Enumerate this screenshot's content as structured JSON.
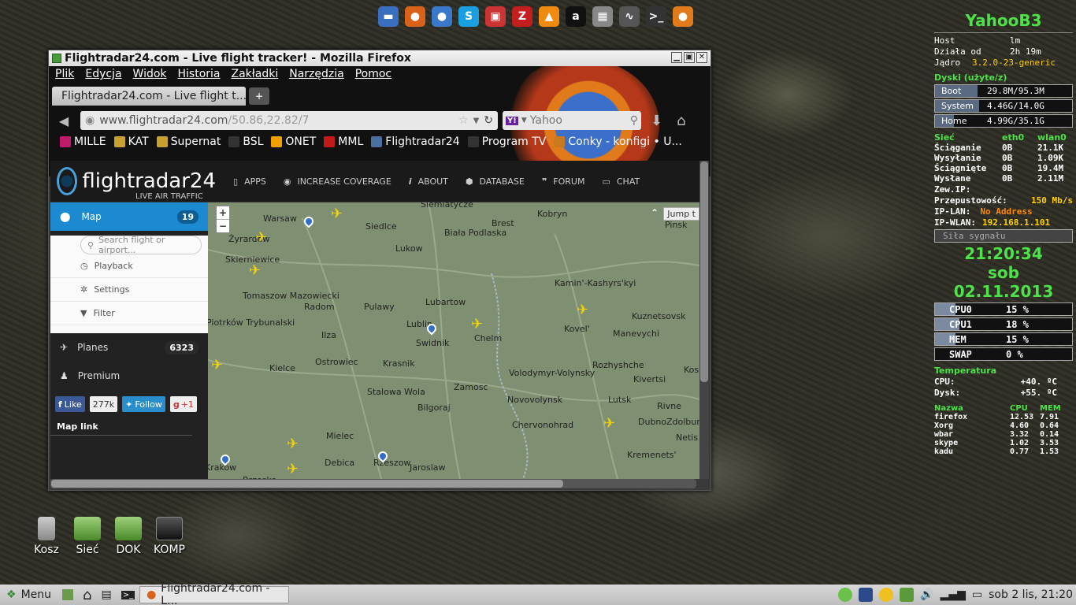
{
  "dock": [
    {
      "name": "files-icon",
      "glyph": "▬",
      "color": "#3a6fbf"
    },
    {
      "name": "firefox-icon",
      "glyph": "●",
      "color": "#d8621a"
    },
    {
      "name": "thunderbird-icon",
      "glyph": "●",
      "color": "#3a78c9"
    },
    {
      "name": "skype-icon",
      "glyph": "S",
      "color": "#1aa0e0"
    },
    {
      "name": "package-icon",
      "glyph": "▣",
      "color": "#c33"
    },
    {
      "name": "filezilla-icon",
      "glyph": "Z",
      "color": "#c41e1e"
    },
    {
      "name": "vlc-icon",
      "glyph": "▲",
      "color": "#f08a10"
    },
    {
      "name": "amazon-icon",
      "glyph": "a",
      "color": "#111"
    },
    {
      "name": "network-icon",
      "glyph": "▦",
      "color": "#888"
    },
    {
      "name": "monitor-icon",
      "glyph": "∿",
      "color": "#555"
    },
    {
      "name": "terminal-icon",
      "glyph": ">_",
      "color": "#333"
    },
    {
      "name": "firefox2-icon",
      "glyph": "●",
      "color": "#e07a1a"
    }
  ],
  "window": {
    "title": "Flightradar24.com - Live flight tracker! - Mozilla Firefox",
    "menu": [
      "Plik",
      "Edycja",
      "Widok",
      "Historia",
      "Zakładki",
      "Narzędzia",
      "Pomoc"
    ],
    "tab_title": "Flightradar24.com - Live flight t...",
    "url_host": "www.flightradar24.com",
    "url_path": "/50.86,22.82/7",
    "search_engine": "Yahoo",
    "bookmarks": [
      {
        "label": "MILLE",
        "color": "#c21a6a"
      },
      {
        "label": "KAT",
        "color": "#c8a030"
      },
      {
        "label": "Supernat",
        "color": "#c8a030"
      },
      {
        "label": "BSL",
        "color": "#333"
      },
      {
        "label": "ONET",
        "color": "#f0a000"
      },
      {
        "label": "MML",
        "color": "#c21a1a"
      },
      {
        "label": "Flightradar24",
        "color": "#4a6fa0"
      },
      {
        "label": "Program TV",
        "color": "#333"
      },
      {
        "label": "Conky - konfigi • U...",
        "color": "#c87a20"
      }
    ]
  },
  "site": {
    "logo": "flightradar24",
    "tagline": "LIVE AIR TRAFFIC",
    "nav": [
      "APPS",
      "INCREASE COVERAGE",
      "ABOUT",
      "DATABASE",
      "FORUM",
      "CHAT"
    ],
    "sidebar": {
      "map_label": "Map",
      "map_count": "19",
      "search_placeholder": "Search flight or airport...",
      "playback": "Playback",
      "settings": "Settings",
      "filter": "Filter",
      "planes_label": "Planes",
      "planes_count": "6323",
      "premium": "Premium",
      "like": "Like",
      "like_count": "277k",
      "follow": "Follow",
      "gplus": "+1",
      "map_link": "Map link"
    },
    "map": {
      "zoom_in": "+",
      "zoom_out": "−",
      "jump": "Jump t",
      "cities": [
        "Warsaw",
        "Siedlce",
        "Biała Podlaska",
        "Brest",
        "Kobryn",
        "Pinsk",
        "Żyrardów",
        "Lukow",
        "Skierniewice",
        "Kamin'-Kashyrs'kyi",
        "Tomaszow Mazowiecki",
        "Radom",
        "Pulawy",
        "Lubartow",
        "Kuznetsovsk",
        "Piotrków Trybunalski",
        "Ilza",
        "Lublin",
        "Swidnik",
        "Chelm",
        "Kovel'",
        "Manevychi",
        "Ostrowiec",
        "Krasnik",
        "Kielce",
        "Volodymyr-Volynsky",
        "Rozhyshche",
        "Kos",
        "Zamosc",
        "Kivertsi",
        "Stalowa Wola",
        "Bilgoraj",
        "Novovolynsk",
        "Lutsk",
        "Rivne",
        "Dubno",
        "Zdolbun",
        "Chervonohrad",
        "Mielec",
        "Netis",
        "Kremenets'",
        "Debica",
        "Rzeszow",
        "Jaroslaw",
        "Kraków",
        "Brzesko",
        "Siemiatycze"
      ]
    }
  },
  "desktop_icons": [
    "Kosz",
    "Sieć",
    "DOK",
    "KOMP"
  ],
  "conky": {
    "title": "YahooB3",
    "host_label": "Host",
    "host": "lm",
    "uptime_label": "Działa od",
    "uptime": "2h 19m",
    "kernel_label": "Jądro",
    "kernel": "3.2.0-23-generic",
    "disks_head": "Dyski (użyte/z)",
    "disks": [
      {
        "name": "Boot",
        "value": "29.8M/95.3M",
        "fill": 0.31
      },
      {
        "name": "System",
        "value": "4.46G/14.0G",
        "fill": 0.32
      },
      {
        "name": "Home",
        "value": "4.99G/35.1G",
        "fill": 0.14
      }
    ],
    "net_head": "Sieć",
    "net_cols": [
      "eth0",
      "wlan0"
    ],
    "net_rows": [
      {
        "k": "Ściąganie",
        "a": "0B",
        "b": "21.1K"
      },
      {
        "k": "Wysyłanie",
        "a": "0B",
        "b": "1.09K"
      },
      {
        "k": "Ściągnięte",
        "a": "0B",
        "b": "19.4M"
      },
      {
        "k": "Wysłane",
        "a": "0B",
        "b": "2.11M"
      }
    ],
    "ext_ip_label": "Zew.IP:",
    "throughput_label": "Przepustowość:",
    "throughput": "150 Mb/s",
    "ip_lan_label": "IP-LAN:",
    "ip_lan": "No Address",
    "ip_wlan_label": "IP-WLAN:",
    "ip_wlan": "192.168.1.101",
    "signal_label": "Siła sygnału",
    "time": "21:20:34",
    "day": "sob",
    "date": "02.11.2013",
    "bars": [
      {
        "name": "CPU0",
        "value": "15 %",
        "fill": 0.15
      },
      {
        "name": "CPU1",
        "value": "18 %",
        "fill": 0.18
      },
      {
        "name": "MEM",
        "value": "15 %",
        "fill": 0.15
      },
      {
        "name": "SWAP",
        "value": "0 %",
        "fill": 0.0
      }
    ],
    "temp_head": "Temperatura",
    "temp_cpu_label": "CPU:",
    "temp_cpu": "+40. ºC",
    "temp_disk_label": "Dysk:",
    "temp_disk": "+55. ºC",
    "proc_head": [
      "Nazwa",
      "CPU",
      "MEM"
    ],
    "procs": [
      [
        "firefox",
        "12.53",
        "7.91"
      ],
      [
        "Xorg",
        "4.60",
        "0.64"
      ],
      [
        "wbar",
        "3.32",
        "0.14"
      ],
      [
        "skype",
        "1.02",
        "3.53"
      ],
      [
        "kadu",
        "0.77",
        "1.53"
      ]
    ]
  },
  "taskbar": {
    "menu": "Menu",
    "task": "Flightradar24.com - L...",
    "clock": "sob  2 lis, 21:20"
  }
}
